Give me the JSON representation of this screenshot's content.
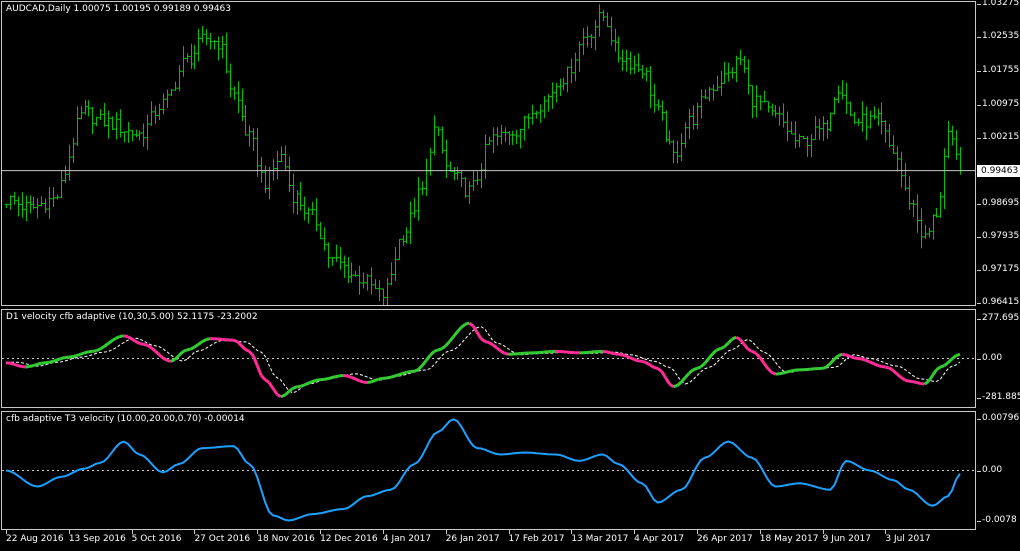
{
  "main": {
    "title": "AUDCAD,Daily  1.00075 1.00195 0.99189 0.99463",
    "current_price": "0.99463",
    "y_ticks": [
      {
        "label": "1.03275",
        "v": 1.03275
      },
      {
        "label": "1.02535",
        "v": 1.02535
      },
      {
        "label": "1.01755",
        "v": 1.01755
      },
      {
        "label": "1.00975",
        "v": 1.00975
      },
      {
        "label": "1.00215",
        "v": 1.00215
      },
      {
        "label": "0.98695",
        "v": 0.98695
      },
      {
        "label": "0.97935",
        "v": 0.97935
      },
      {
        "label": "0.97175",
        "v": 0.97175
      },
      {
        "label": "0.96415",
        "v": 0.96415
      }
    ],
    "ylim": [
      0.9638,
      1.0333
    ],
    "bar_color": "#00c000"
  },
  "ind1": {
    "title": "D1 velocity cfb adaptive (10,30,5.00) 52.1175 -23.2002",
    "y_ticks": [
      {
        "label": "277.6953",
        "v": 277.6953
      },
      {
        "label": "0.00",
        "v": 0
      },
      {
        "label": "-281.8853",
        "v": -281.8853
      }
    ],
    "ylim": [
      -300,
      300
    ],
    "up_color": "#33cc33",
    "down_color": "#ff2d95"
  },
  "ind2": {
    "title": "cfb adaptive T3 velocity (10.00,20.00,0.70) -0.00014",
    "y_ticks": [
      {
        "label": "0.00796",
        "v": 0.00796
      },
      {
        "label": "0.00",
        "v": 0
      },
      {
        "label": "-0.0078",
        "v": -0.0078
      }
    ],
    "ylim": [
      -0.0085,
      0.0085
    ],
    "line_color": "#1ea0ff"
  },
  "x_axis": [
    {
      "label": "22 Aug 2016",
      "i": 0
    },
    {
      "label": "13 Sep 2016",
      "i": 16
    },
    {
      "label": "5 Oct 2016",
      "i": 32
    },
    {
      "label": "27 Oct 2016",
      "i": 48
    },
    {
      "label": "18 Nov 2016",
      "i": 64
    },
    {
      "label": "12 Dec 2016",
      "i": 80
    },
    {
      "label": "4 Jan 2017",
      "i": 96
    },
    {
      "label": "26 Jan 2017",
      "i": 112
    },
    {
      "label": "17 Feb 2017",
      "i": 128
    },
    {
      "label": "13 Mar 2017",
      "i": 144
    },
    {
      "label": "4 Apr 2017",
      "i": 160
    },
    {
      "label": "26 Apr 2017",
      "i": 176
    },
    {
      "label": "18 May 2017",
      "i": 192
    },
    {
      "label": "9 Jun 2017",
      "i": 208
    },
    {
      "label": "3 Jul 2017",
      "i": 224
    }
  ],
  "chart_data": {
    "type": "line",
    "series": [
      {
        "name": "AUDCAD,Daily",
        "anchors": [
          [
            0,
            0.988
          ],
          [
            6,
            0.986
          ],
          [
            12,
            0.988
          ],
          [
            20,
            1.008
          ],
          [
            24,
            1.006
          ],
          [
            34,
            1.003
          ],
          [
            40,
            1.01
          ],
          [
            46,
            1.02
          ],
          [
            51,
            1.025
          ],
          [
            54,
            1.024
          ],
          [
            58,
            1.012
          ],
          [
            62,
            1.002
          ],
          [
            66,
            0.992
          ],
          [
            70,
            0.998
          ],
          [
            73,
            0.989
          ],
          [
            78,
            0.984
          ],
          [
            83,
            0.974
          ],
          [
            90,
            0.97
          ],
          [
            96,
            0.966
          ],
          [
            101,
            0.98
          ],
          [
            106,
            0.99
          ],
          [
            109,
            1.004
          ],
          [
            113,
            0.994
          ],
          [
            118,
            0.99
          ],
          [
            124,
            1.002
          ],
          [
            130,
            1.004
          ],
          [
            136,
            1.01
          ],
          [
            142,
            1.016
          ],
          [
            148,
            1.026
          ],
          [
            152,
            1.03
          ],
          [
            156,
            1.021
          ],
          [
            162,
            1.018
          ],
          [
            166,
            1.008
          ],
          [
            170,
            0.998
          ],
          [
            174,
            1.006
          ],
          [
            180,
            1.014
          ],
          [
            183,
            1.016
          ],
          [
            187,
            1.02
          ],
          [
            190,
            1.011
          ],
          [
            196,
            1.007
          ],
          [
            202,
            1.001
          ],
          [
            208,
            1.004
          ],
          [
            212,
            1.014
          ],
          [
            216,
            1.006
          ],
          [
            222,
            1.006
          ],
          [
            226,
            0.999
          ],
          [
            230,
            0.988
          ],
          [
            234,
            0.979
          ],
          [
            237,
            0.985
          ],
          [
            240,
            1.002
          ],
          [
            243,
            0.996
          ]
        ]
      },
      {
        "name": "D1 velocity cfb adaptive",
        "anchors": [
          [
            0,
            -30
          ],
          [
            5,
            -60
          ],
          [
            10,
            -30
          ],
          [
            16,
            10
          ],
          [
            22,
            50
          ],
          [
            30,
            160
          ],
          [
            35,
            100
          ],
          [
            42,
            -20
          ],
          [
            46,
            60
          ],
          [
            52,
            140
          ],
          [
            58,
            130
          ],
          [
            62,
            50
          ],
          [
            66,
            -150
          ],
          [
            70,
            -270
          ],
          [
            74,
            -200
          ],
          [
            80,
            -150
          ],
          [
            86,
            -120
          ],
          [
            92,
            -170
          ],
          [
            96,
            -140
          ],
          [
            104,
            -90
          ],
          [
            110,
            60
          ],
          [
            118,
            250
          ],
          [
            122,
            120
          ],
          [
            128,
            30
          ],
          [
            134,
            40
          ],
          [
            140,
            50
          ],
          [
            146,
            40
          ],
          [
            152,
            50
          ],
          [
            156,
            30
          ],
          [
            162,
            -20
          ],
          [
            166,
            -70
          ],
          [
            170,
            -200
          ],
          [
            176,
            -70
          ],
          [
            182,
            70
          ],
          [
            186,
            150
          ],
          [
            190,
            50
          ],
          [
            196,
            -110
          ],
          [
            202,
            -80
          ],
          [
            208,
            -70
          ],
          [
            213,
            30
          ],
          [
            217,
            0
          ],
          [
            224,
            -60
          ],
          [
            230,
            -160
          ],
          [
            234,
            -180
          ],
          [
            238,
            -60
          ],
          [
            243,
            30
          ]
        ]
      },
      {
        "name": "cfb adaptive T3 velocity",
        "anchors": [
          [
            0,
            0.0
          ],
          [
            8,
            -0.0025
          ],
          [
            14,
            -0.001
          ],
          [
            20,
            0.0003
          ],
          [
            24,
            0.0012
          ],
          [
            30,
            0.0045
          ],
          [
            34,
            0.0025
          ],
          [
            40,
            -0.0003
          ],
          [
            44,
            0.001
          ],
          [
            50,
            0.0035
          ],
          [
            58,
            0.0038
          ],
          [
            62,
            0.001
          ],
          [
            68,
            -0.007
          ],
          [
            72,
            -0.0078
          ],
          [
            78,
            -0.0068
          ],
          [
            86,
            -0.006
          ],
          [
            92,
            -0.004
          ],
          [
            98,
            -0.003
          ],
          [
            104,
            0.001
          ],
          [
            110,
            0.006
          ],
          [
            114,
            0.008
          ],
          [
            120,
            0.0035
          ],
          [
            126,
            0.0025
          ],
          [
            132,
            0.0028
          ],
          [
            140,
            0.0025
          ],
          [
            146,
            0.0015
          ],
          [
            152,
            0.0025
          ],
          [
            156,
            0.001
          ],
          [
            162,
            -0.002
          ],
          [
            166,
            -0.005
          ],
          [
            172,
            -0.003
          ],
          [
            178,
            0.002
          ],
          [
            184,
            0.0045
          ],
          [
            190,
            0.002
          ],
          [
            196,
            -0.0025
          ],
          [
            202,
            -0.002
          ],
          [
            210,
            -0.003
          ],
          [
            214,
            0.0015
          ],
          [
            220,
            0.0
          ],
          [
            226,
            -0.0015
          ],
          [
            230,
            -0.003
          ],
          [
            236,
            -0.0055
          ],
          [
            240,
            -0.004
          ],
          [
            243,
            -0.0005
          ]
        ]
      }
    ],
    "n_bars": 244
  }
}
